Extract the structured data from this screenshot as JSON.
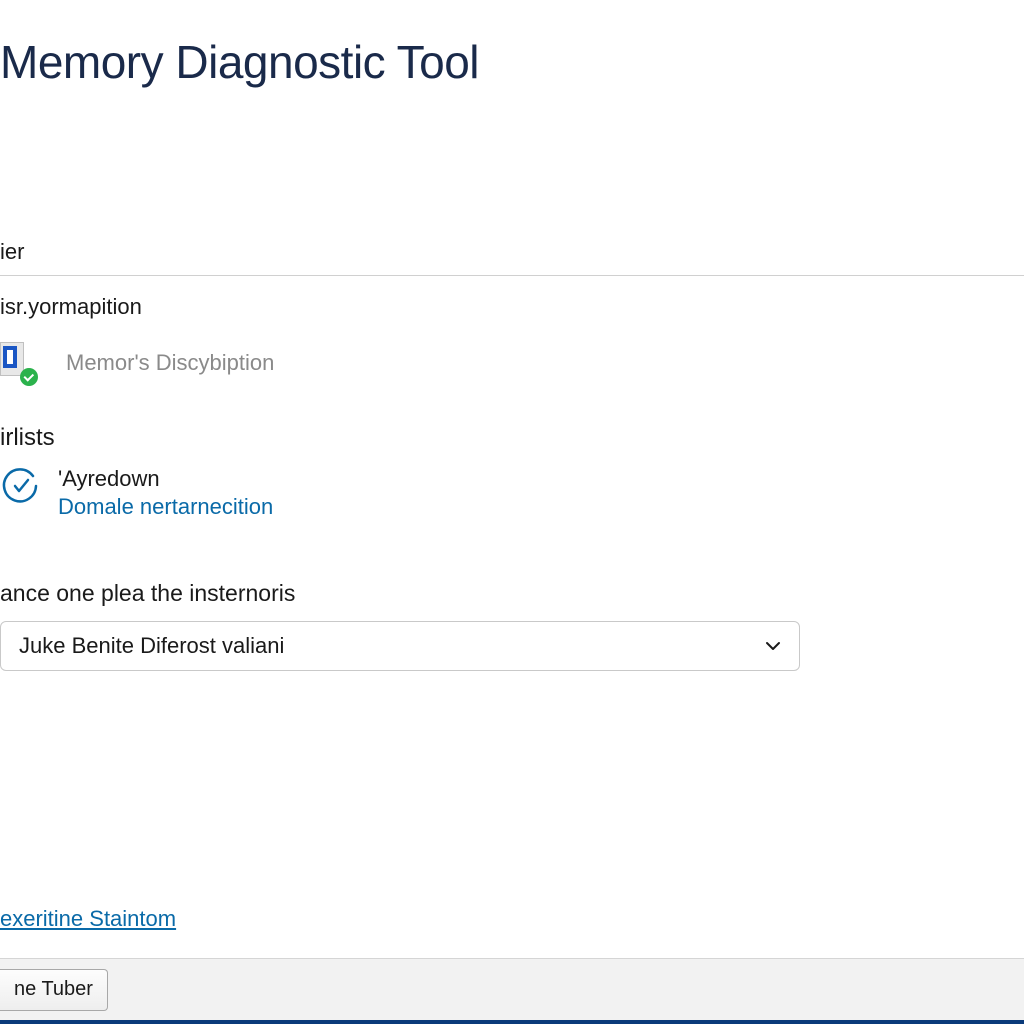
{
  "header": {
    "title": "Memory Diagnostic Tool"
  },
  "tab": {
    "label": "ier"
  },
  "section_info": {
    "heading": "isr.yormapition",
    "description": "Memor's Discybiption"
  },
  "section_lists": {
    "heading": "irlists",
    "item": {
      "primary": "'Ayredown",
      "link": "Domale nertarnecition"
    }
  },
  "prompt": {
    "label": "ance one plea the insternoris"
  },
  "dropdown": {
    "selected": "Juke Benite Diferost valiani"
  },
  "bottom_link": {
    "label": "exeritine Staintom"
  },
  "footer": {
    "button_label": "ne Tuber"
  }
}
